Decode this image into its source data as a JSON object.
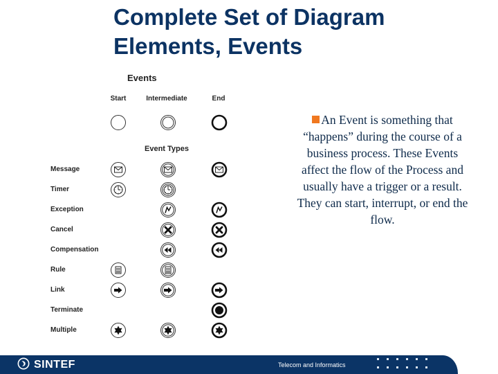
{
  "slide": {
    "title_line1": "Complete Set of Diagram",
    "title_line2": "Elements, Events"
  },
  "diagram": {
    "heading": "Events",
    "columns": [
      "Start",
      "Intermediate",
      "End"
    ],
    "types_heading": "Event Types",
    "rows": [
      {
        "label": "Message",
        "icon": "envelope-icon",
        "start": true,
        "intermediate": true,
        "end": true
      },
      {
        "label": "Timer",
        "icon": "clock-icon",
        "start": true,
        "intermediate": true,
        "end": false
      },
      {
        "label": "Exception",
        "icon": "lightning-icon",
        "start": false,
        "intermediate": true,
        "end": true
      },
      {
        "label": "Cancel",
        "icon": "x-icon",
        "start": false,
        "intermediate": true,
        "end": true
      },
      {
        "label": "Compensation",
        "icon": "rewind-icon",
        "start": false,
        "intermediate": true,
        "end": true
      },
      {
        "label": "Rule",
        "icon": "document-icon",
        "start": true,
        "intermediate": true,
        "end": false
      },
      {
        "label": "Link",
        "icon": "arrow-right-icon",
        "start": true,
        "intermediate": true,
        "end": true
      },
      {
        "label": "Terminate",
        "icon": "filled-circle-icon",
        "start": false,
        "intermediate": false,
        "end": true
      },
      {
        "label": "Multiple",
        "icon": "star-icon",
        "start": true,
        "intermediate": true,
        "end": true
      }
    ]
  },
  "body": {
    "bullet_color": "#f07820",
    "text": "An Event is something that “happens” during the course of a business process. These Events affect the flow of the Process and usually have a trigger or a result. They can start, interrupt, or end the flow."
  },
  "footer": {
    "logo_text": "SINTEF",
    "logo_icon": "sintef-logo-icon",
    "department": "Telecom and Informatics",
    "background": "#0b3466"
  }
}
